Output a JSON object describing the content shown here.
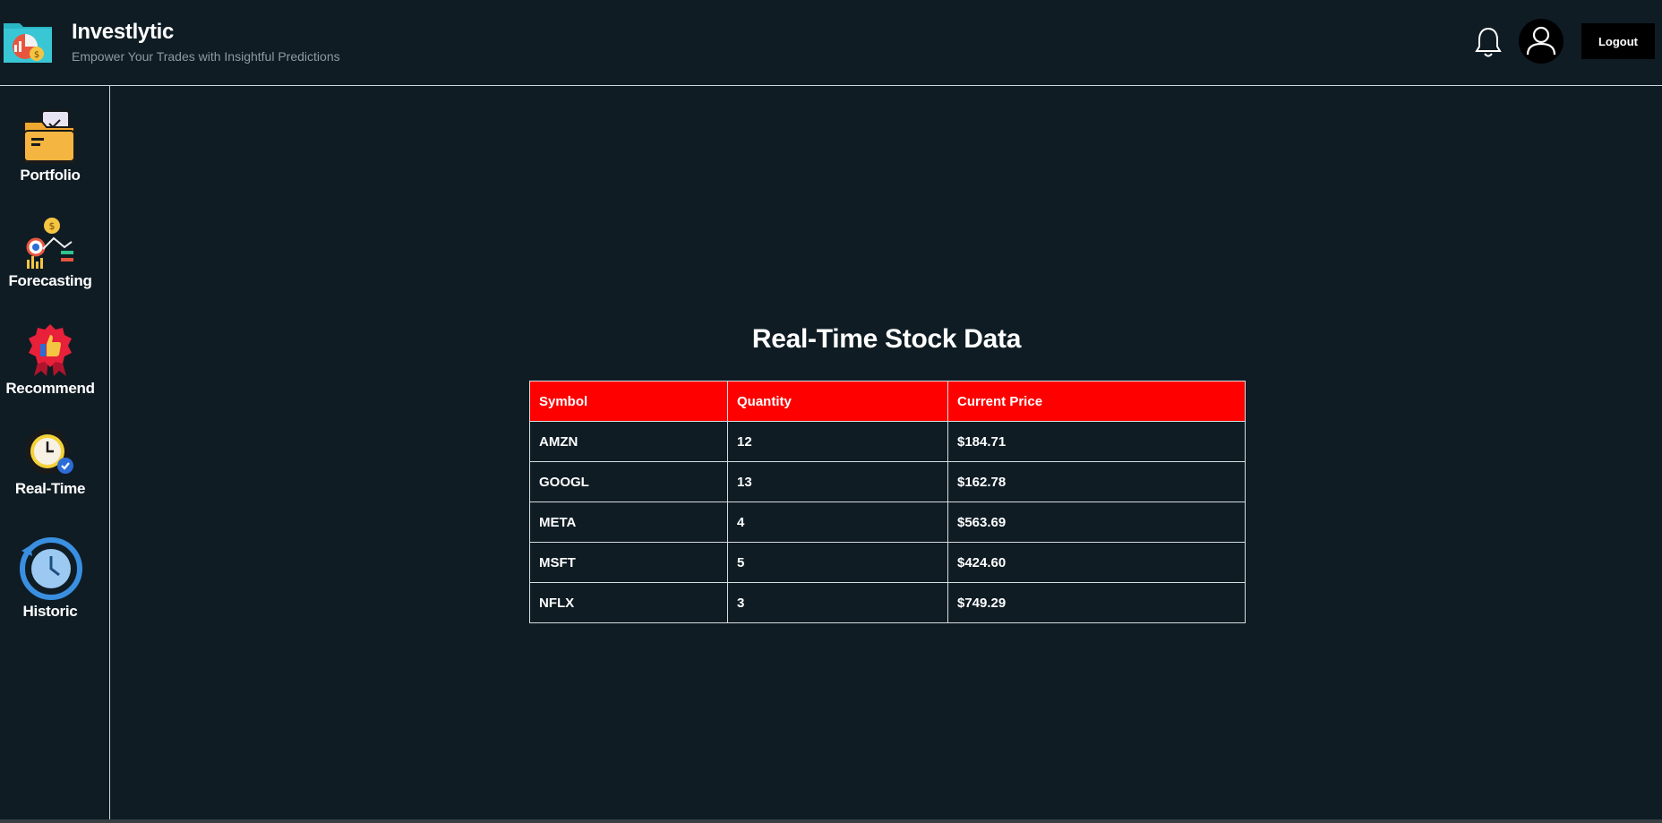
{
  "header": {
    "title": "Investlytic",
    "subtitle": "Empower Your Trades with Insightful Predictions",
    "logout_label": "Logout"
  },
  "sidebar": {
    "items": [
      {
        "label": "Portfolio",
        "icon": "folder-icon"
      },
      {
        "label": "Forecasting",
        "icon": "forecast-chart-icon"
      },
      {
        "label": "Recommend",
        "icon": "thumbs-up-badge-icon"
      },
      {
        "label": "Real-Time",
        "icon": "clock-check-icon"
      },
      {
        "label": "Historic",
        "icon": "history-clock-icon"
      }
    ]
  },
  "main": {
    "title": "Real-Time Stock Data",
    "table": {
      "columns": [
        "Symbol",
        "Quantity",
        "Current Price"
      ],
      "rows": [
        [
          "AMZN",
          "12",
          "$184.71"
        ],
        [
          "GOOGL",
          "13",
          "$162.78"
        ],
        [
          "META",
          "4",
          "$563.69"
        ],
        [
          "MSFT",
          "5",
          "$424.60"
        ],
        [
          "NFLX",
          "3",
          "$749.29"
        ]
      ]
    }
  },
  "colors": {
    "background": "#0f1c24",
    "table_header": "#ff0000",
    "subtitle": "#8c9aa3"
  }
}
